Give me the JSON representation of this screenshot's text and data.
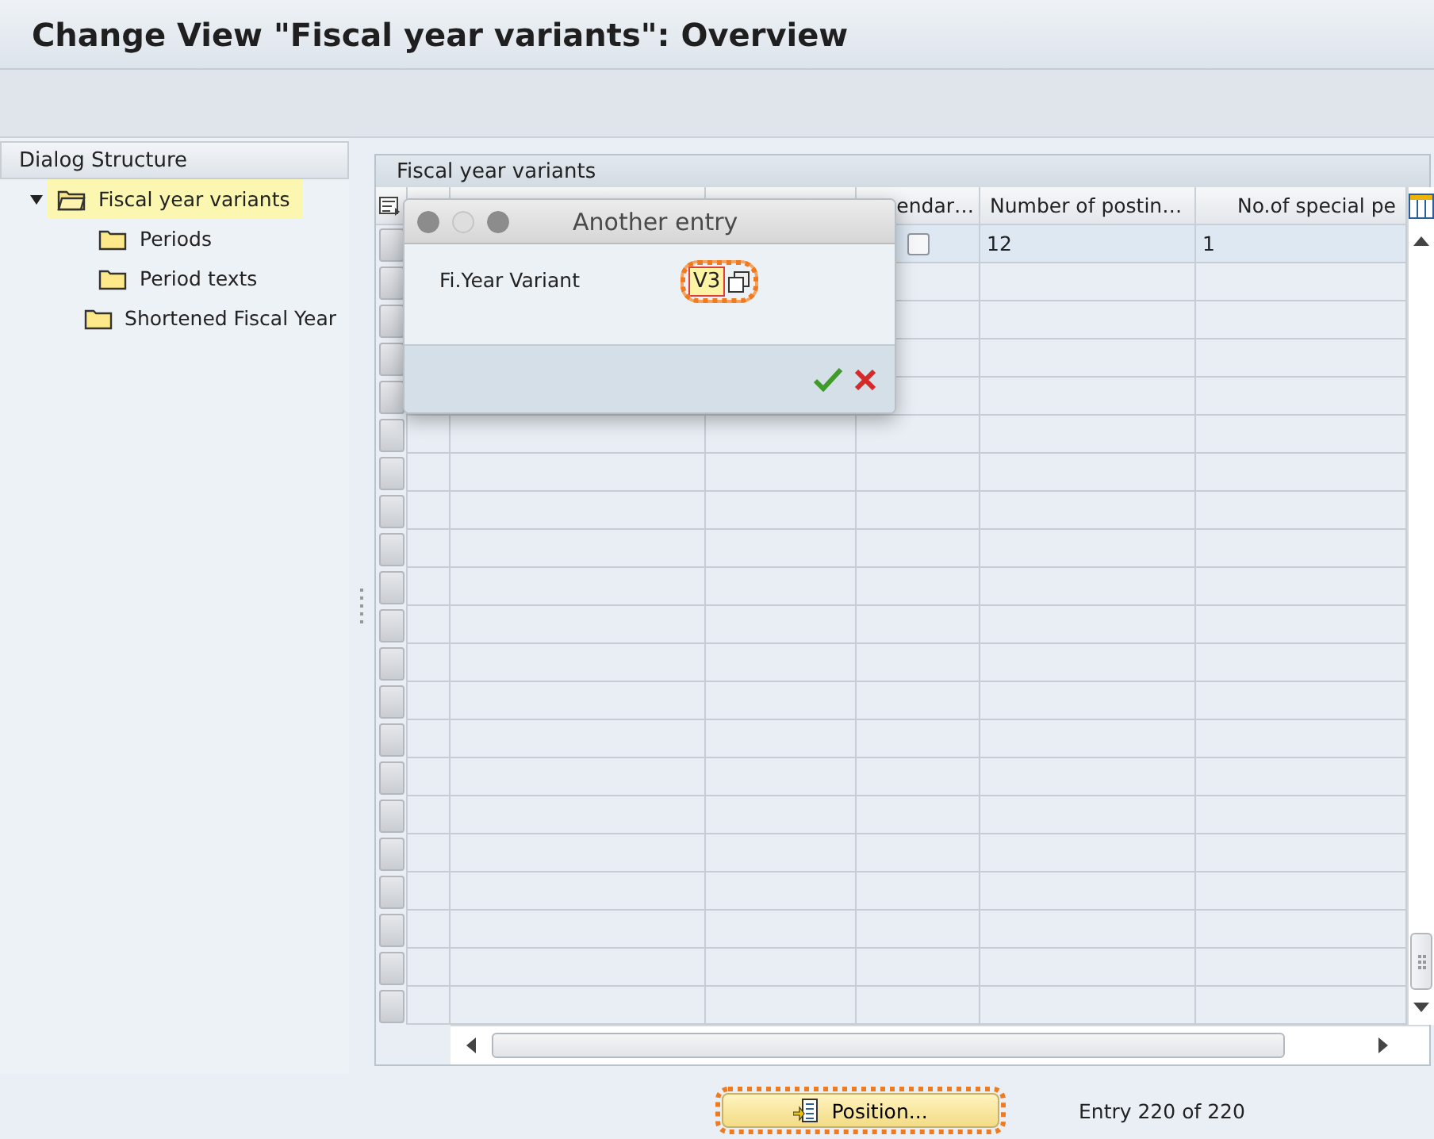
{
  "window": {
    "title": "Change View \"Fiscal year variants\": Overview"
  },
  "dialog_structure": {
    "title": "Dialog Structure",
    "items": [
      {
        "label": "Fiscal year variants",
        "selected": true,
        "expanded": true,
        "children": [
          {
            "label": "Periods",
            "selected": false
          },
          {
            "label": "Period texts",
            "selected": false
          },
          {
            "label": "Shortened Fiscal Year",
            "selected": false
          }
        ]
      }
    ]
  },
  "table": {
    "title": "Fiscal year variants",
    "columns": [
      {
        "label": "endar…"
      },
      {
        "label": "Number of postin…"
      },
      {
        "label": "No.of special pe"
      }
    ],
    "rows": [
      {
        "calendar_year_checked": false,
        "number_of_postings": "12",
        "special_periods": "1"
      }
    ]
  },
  "dialog": {
    "title": "Another entry",
    "field": {
      "label": "Fi.Year Variant",
      "value": "V3",
      "highlighted": true
    }
  },
  "footer": {
    "position_button": {
      "label": "Position...",
      "highlighted": true
    },
    "status": "Entry 220 of 220"
  }
}
